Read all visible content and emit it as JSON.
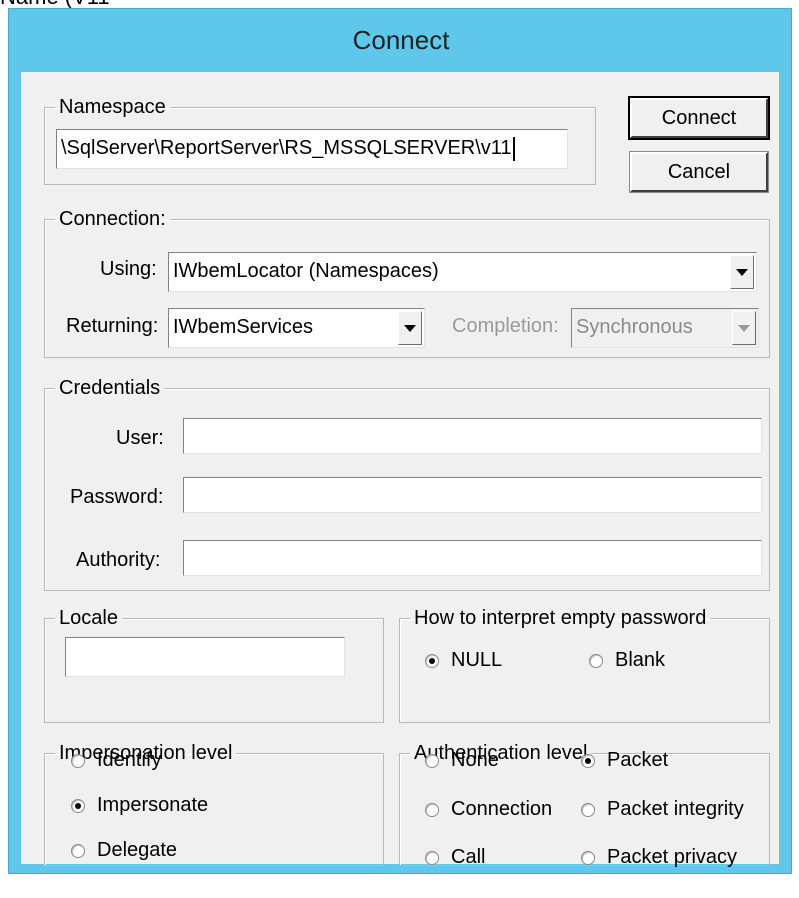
{
  "partial_top_text": "Name    (V11",
  "dialog": {
    "title": "Connect",
    "buttons": {
      "connect": "Connect",
      "cancel": "Cancel"
    }
  },
  "namespace": {
    "legend": "Namespace",
    "value": "\\SqlServer\\ReportServer\\RS_MSSQLSERVER\\v11"
  },
  "connection": {
    "legend": "Connection:",
    "using_label": "Using:",
    "using_value": "IWbemLocator (Namespaces)",
    "returning_label": "Returning:",
    "returning_value": "IWbemServices",
    "completion_label": "Completion:",
    "completion_value": "Synchronous"
  },
  "credentials": {
    "legend": "Credentials",
    "user_label": "User:",
    "user_value": "",
    "password_label": "Password:",
    "password_value": "",
    "authority_label": "Authority:",
    "authority_value": ""
  },
  "locale": {
    "legend": "Locale",
    "value": ""
  },
  "empty_password": {
    "legend": "How to interpret empty password",
    "options": [
      "NULL",
      "Blank"
    ],
    "selected": "NULL"
  },
  "impersonation": {
    "legend": "Impersonation level",
    "options": [
      "Identify",
      "Impersonate",
      "Delegate"
    ],
    "selected": "Impersonate"
  },
  "authentication": {
    "legend": "Authentication level",
    "options": [
      "None",
      "Packet",
      "Connection",
      "Packet integrity",
      "Call",
      "Packet privacy"
    ],
    "selected": "Packet"
  }
}
